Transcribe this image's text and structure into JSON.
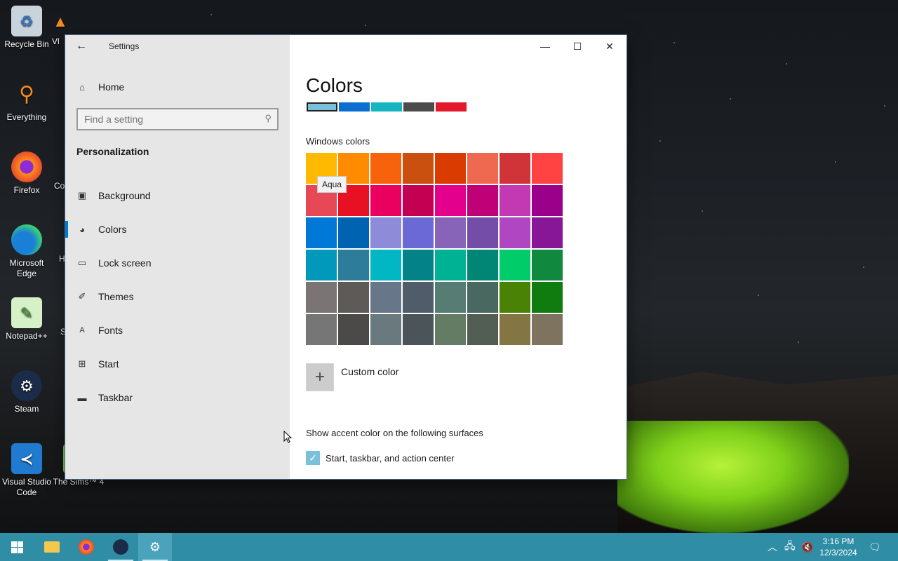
{
  "desktop": {
    "icons": [
      {
        "label": "Recycle Bin",
        "icon": "recycle-bin-icon"
      },
      {
        "label": "Everything",
        "icon": "everything-search-icon"
      },
      {
        "label": "Firefox",
        "icon": "firefox-icon"
      },
      {
        "label": "Microsoft Edge",
        "icon": "edge-icon"
      },
      {
        "label": "Notepad++",
        "icon": "notepadpp-icon"
      },
      {
        "label": "Steam",
        "icon": "steam-icon"
      },
      {
        "label": "Visual Studio Code",
        "icon": "vscode-icon"
      },
      {
        "label": "The Sims™ 4",
        "icon": "sims-icon"
      },
      {
        "label": "Vl",
        "icon": "vlc-icon"
      },
      {
        "label": "Co",
        "icon": "partial-icon"
      },
      {
        "label": "H",
        "icon": "partial-icon"
      },
      {
        "label": "S",
        "icon": "partial-icon"
      }
    ]
  },
  "window": {
    "title": "Settings",
    "back_glyph": "←",
    "controls": {
      "minimize": "—",
      "maximize": "☐",
      "close": "✕"
    }
  },
  "sidebar": {
    "home_label": "Home",
    "search_placeholder": "Find a setting",
    "section_label": "Personalization",
    "items": [
      {
        "label": "Background",
        "icon": "picture-icon",
        "active": false
      },
      {
        "label": "Colors",
        "icon": "palette-icon",
        "active": true
      },
      {
        "label": "Lock screen",
        "icon": "lock-screen-icon",
        "active": false
      },
      {
        "label": "Themes",
        "icon": "themes-icon",
        "active": false
      },
      {
        "label": "Fonts",
        "icon": "fonts-icon",
        "active": false
      },
      {
        "label": "Start",
        "icon": "start-icon",
        "active": false
      },
      {
        "label": "Taskbar",
        "icon": "taskbar-icon",
        "active": false
      }
    ]
  },
  "main": {
    "title": "Colors",
    "recent_colors": [
      "#79c1d8",
      "#0a6fd1",
      "#15b5c1",
      "#4c4c4c",
      "#e21a2b"
    ],
    "windows_colors_label": "Windows colors",
    "tooltip": "Aqua",
    "swatches": [
      "#ffb900",
      "#ff8c00",
      "#f7630c",
      "#ca5010",
      "#da3b01",
      "#ef6950",
      "#d13438",
      "#ff4343",
      "#e74856",
      "#e81123",
      "#ea005e",
      "#c30052",
      "#e3008c",
      "#bf0077",
      "#c239b3",
      "#9a0089",
      "#0078d7",
      "#0063b1",
      "#8e8cd8",
      "#6b69d6",
      "#8764b8",
      "#744da9",
      "#b146c2",
      "#881798",
      "#0099bc",
      "#2d7d9a",
      "#00b7c3",
      "#038387",
      "#00b294",
      "#018574",
      "#00cc6a",
      "#10893e",
      "#7a7574",
      "#5d5a58",
      "#68768a",
      "#515c6b",
      "#567c73",
      "#486860",
      "#498205",
      "#107c10",
      "#767676",
      "#4c4a48",
      "#69797e",
      "#4a5459",
      "#647c64",
      "#525e54",
      "#847545",
      "#7e735f"
    ],
    "custom_color_label": "Custom color",
    "surfaces_label": "Show accent color on the following surfaces",
    "checkbox_label": "Start, taskbar, and action center",
    "checkbox_checked": true
  },
  "taskbar": {
    "pinned": [
      {
        "name": "start-button",
        "icon": "windows-logo-icon"
      },
      {
        "name": "file-explorer",
        "icon": "folder-icon"
      },
      {
        "name": "firefox",
        "icon": "firefox-icon"
      },
      {
        "name": "steam",
        "icon": "steam-icon"
      },
      {
        "name": "settings",
        "icon": "gear-icon"
      }
    ],
    "clock_time": "3:16 PM",
    "clock_date": "12/3/2024"
  }
}
